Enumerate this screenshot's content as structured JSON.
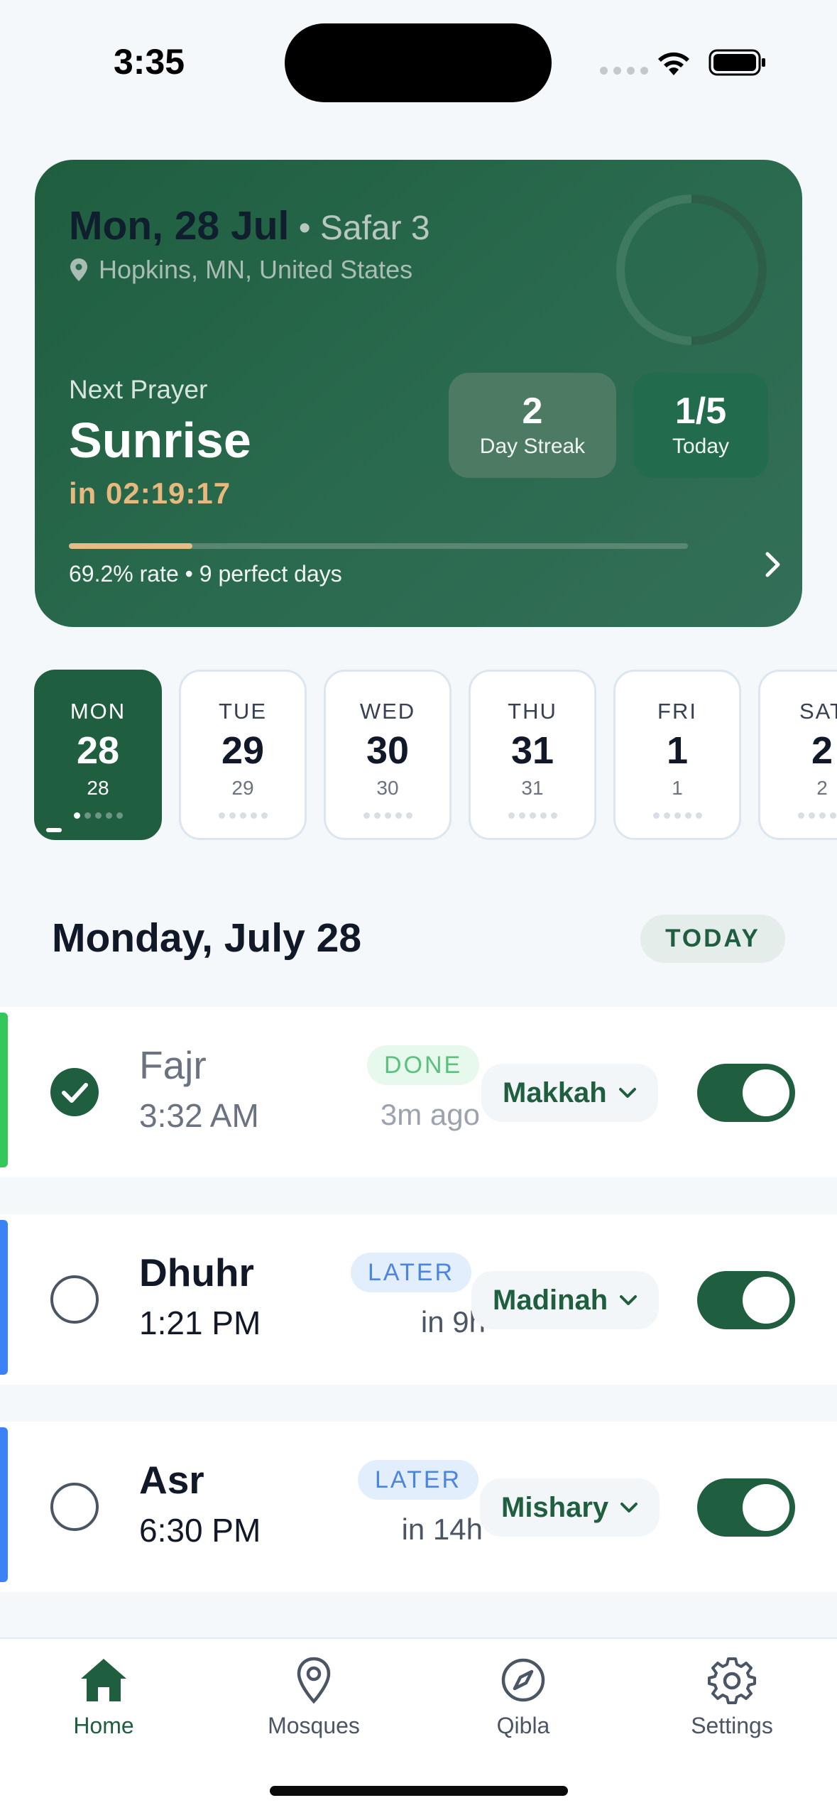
{
  "status_bar": {
    "time": "3:35"
  },
  "hero": {
    "date": "Mon, 28 Jul",
    "hijri": " • Safar 3",
    "location": "Hopkins, MN, United States",
    "next_label": "Next Prayer",
    "next_name": "Sunrise",
    "countdown": "in 02:19:17",
    "streak_value": "2",
    "streak_label": "Day Streak",
    "today_value": "1/5",
    "today_label": "Today",
    "rate_progress": 0.2,
    "rate_text": "69.2% rate • 9 perfect days"
  },
  "days": [
    {
      "name": "MON",
      "num": "28",
      "sub": "28",
      "active": true
    },
    {
      "name": "TUE",
      "num": "29",
      "sub": "29",
      "active": false
    },
    {
      "name": "WED",
      "num": "30",
      "sub": "30",
      "active": false
    },
    {
      "name": "THU",
      "num": "31",
      "sub": "31",
      "active": false
    },
    {
      "name": "FRI",
      "num": "1",
      "sub": "1",
      "active": false
    },
    {
      "name": "SAT",
      "num": "2",
      "sub": "2",
      "active": false
    }
  ],
  "section": {
    "title": "Monday, July 28",
    "badge": "TODAY"
  },
  "prayers": [
    {
      "name": "Fajr",
      "time": "3:32 AM",
      "status": "DONE",
      "relative": "3m ago",
      "reciter": "Makkah",
      "done": true,
      "accent": "#34C759",
      "enabled": true
    },
    {
      "name": "Dhuhr",
      "time": "1:21 PM",
      "status": "LATER",
      "relative": "in 9h",
      "reciter": "Madinah",
      "done": false,
      "accent": "#3B82F6",
      "enabled": true
    },
    {
      "name": "Asr",
      "time": "6:30 PM",
      "status": "LATER",
      "relative": "in 14h",
      "reciter": "Mishary",
      "done": false,
      "accent": "#3B82F6",
      "enabled": true
    }
  ],
  "tabs": [
    {
      "label": "Home",
      "icon": "home-icon",
      "active": true
    },
    {
      "label": "Mosques",
      "icon": "location-pin-icon",
      "active": false
    },
    {
      "label": "Qibla",
      "icon": "compass-icon",
      "active": false
    },
    {
      "label": "Settings",
      "icon": "gear-icon",
      "active": false
    }
  ],
  "colors": {
    "primary": "#1F5E3F",
    "accent_gold": "#E7BB84",
    "done_green": "#34C759",
    "later_blue": "#3B82F6"
  }
}
